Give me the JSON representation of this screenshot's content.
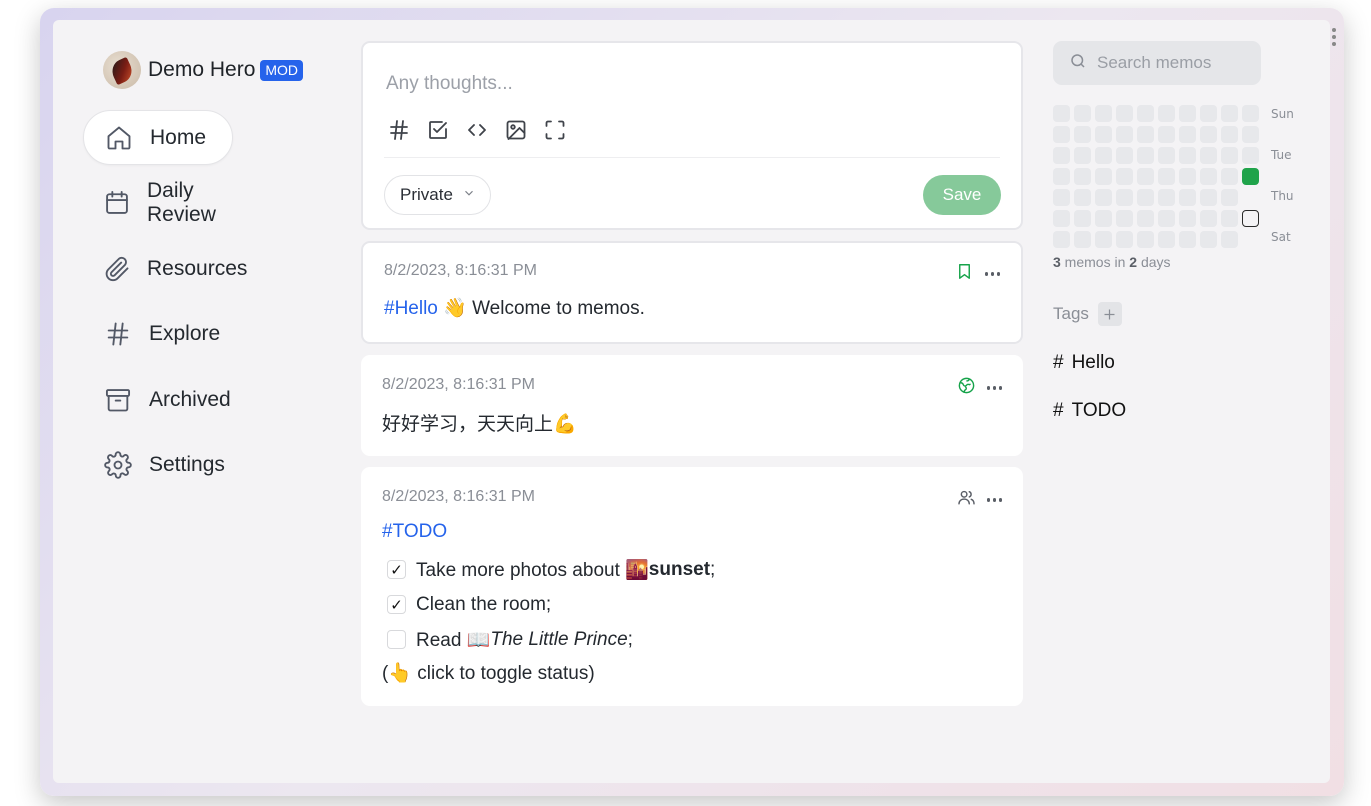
{
  "user": {
    "name": "Demo Hero",
    "role_badge": "MOD"
  },
  "nav": [
    {
      "id": "home",
      "label": "Home",
      "icon": "home-icon",
      "active": true
    },
    {
      "id": "daily-review",
      "label": "Daily Review",
      "icon": "calendar-icon"
    },
    {
      "id": "resources",
      "label": "Resources",
      "icon": "paperclip-icon"
    },
    {
      "id": "explore",
      "label": "Explore",
      "icon": "hash-icon"
    },
    {
      "id": "archived",
      "label": "Archived",
      "icon": "archive-icon"
    },
    {
      "id": "settings",
      "label": "Settings",
      "icon": "gear-icon"
    }
  ],
  "editor": {
    "placeholder": "Any thoughts...",
    "tools": [
      "tag-icon",
      "checkbox-icon",
      "code-icon",
      "image-icon",
      "fullscreen-icon"
    ],
    "visibility": "Private",
    "save_label": "Save"
  },
  "memos": [
    {
      "time": "8/2/2023, 8:16:31 PM",
      "status_icon": "bookmark-icon",
      "tag": "#Hello",
      "text": "👋 Welcome to memos."
    },
    {
      "time": "8/2/2023, 8:16:31 PM",
      "status_icon": "globe-icon",
      "text": "好好学习，天天向上💪"
    },
    {
      "time": "8/2/2023, 8:16:31 PM",
      "status_icon": "users-icon",
      "tag": "#TODO",
      "todos": [
        {
          "checked": true,
          "text_before": "Take more photos about 🌇 ",
          "bold": "sunset",
          "text_after": ";"
        },
        {
          "checked": true,
          "text_before": "Clean the room;",
          "bold": "",
          "text_after": ""
        },
        {
          "checked": false,
          "text_before": "Read 📖 ",
          "italic": "The Little Prince",
          "text_after": ";"
        }
      ],
      "footer": "(👆 click to toggle status)"
    }
  ],
  "sidebar_right": {
    "search_placeholder": "Search memos",
    "heatmap_days": [
      "Sun",
      "Tue",
      "Thu",
      "Sat"
    ],
    "stats": {
      "memos": "3",
      "memos_label": " memos in ",
      "days": "2",
      "days_label": " days"
    },
    "tags_title": "Tags",
    "tags": [
      "Hello",
      "TODO"
    ]
  },
  "colors": {
    "accent": "#2563eb",
    "save_button": "#86c99a",
    "heatmap_active": "#1fa34a",
    "status_public": "#16a34a"
  }
}
